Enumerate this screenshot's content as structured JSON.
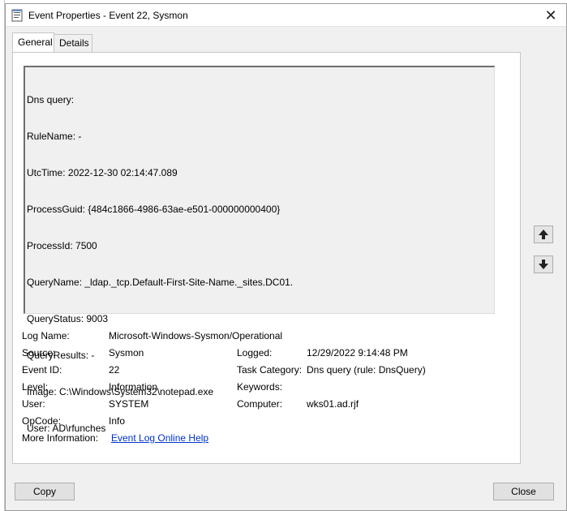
{
  "window": {
    "title": "Event Properties - Event 22, Sysmon",
    "close_glyph": "✕"
  },
  "tabs": [
    {
      "label": "General",
      "active": true
    },
    {
      "label": "Details",
      "active": false
    }
  ],
  "event_text": {
    "lines": [
      "Dns query:",
      "RuleName: -",
      "UtcTime: 2022-12-30 02:14:47.089",
      "ProcessGuid: {484c1866-4986-63ae-e501-000000000400}",
      "ProcessId: 7500",
      "QueryName: _ldap._tcp.Default-First-Site-Name._sites.DC01.",
      "QueryStatus: 9003",
      "QueryResults: -",
      "Image: C:\\Windows\\System32\\notepad.exe",
      "User: AD\\rfunches"
    ]
  },
  "properties": {
    "log_name": {
      "label": "Log Name:",
      "value": "Microsoft-Windows-Sysmon/Operational"
    },
    "source": {
      "label": "Source:",
      "value": "Sysmon"
    },
    "logged": {
      "label": "Logged:",
      "value": "12/29/2022 9:14:48 PM"
    },
    "event_id": {
      "label": "Event ID:",
      "value": "22"
    },
    "task_category": {
      "label": "Task Category:",
      "value": "Dns query (rule: DnsQuery)"
    },
    "level": {
      "label": "Level:",
      "value": "Information"
    },
    "keywords": {
      "label": "Keywords:",
      "value": ""
    },
    "user": {
      "label": "User:",
      "value": "SYSTEM"
    },
    "computer": {
      "label": "Computer:",
      "value": "wks01.ad.rjf"
    },
    "opcode": {
      "label": "OpCode:",
      "value": "Info"
    },
    "more_info": {
      "label": "More Information:",
      "link": "Event Log Online Help"
    }
  },
  "nav": {
    "up_icon": "arrow-up-icon",
    "down_icon": "arrow-down-icon"
  },
  "buttons": {
    "copy": "Copy",
    "close": "Close"
  },
  "colors": {
    "dialog_bg": "#f0f0f0",
    "link": "#0033cc"
  }
}
